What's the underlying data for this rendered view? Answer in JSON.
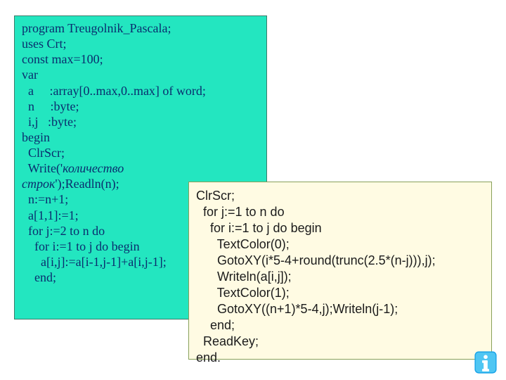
{
  "box1": {
    "l1": "program Treugolnik_Pascala;",
    "l2": "uses Crt;",
    "l3": "const max=100;",
    "l4": "var",
    "l5": "  a     :array[0..max,0..max] of word;",
    "l6": "  n     :byte;",
    "l7": "  i,j   :byte;",
    "l8": "begin",
    "l9": "  ClrScr;",
    "l10a": "  Write('",
    "l10b": "количество",
    "l11a": "строк",
    "l11b": "');Readln(n);",
    "l12": "  n:=n+1;",
    "l13": "  a[1,1]:=1;",
    "l14": "  for j:=2 to n do",
    "l15": "    for i:=1 to j do begin",
    "l16": "      a[i,j]:=a[i-1,j-1]+a[i,j-1];",
    "l17": "    end;"
  },
  "box2": {
    "l1": "ClrScr;",
    "l2": "  for j:=1 to n do",
    "l3": "    for i:=1 to j do begin",
    "l4": "      TextColor(0);",
    "l5": "      GotoXY(i*5-4+round(trunc(2.5*(n-j))),j);",
    "l6": "      Writeln(a[i,j]);",
    "l7": "      TextColor(1);",
    "l8": "      GotoXY((n+1)*5-4,j);Writeln(j-1);",
    "l9": "    end;",
    "l10": "  ReadKey;",
    "l11": "end."
  }
}
